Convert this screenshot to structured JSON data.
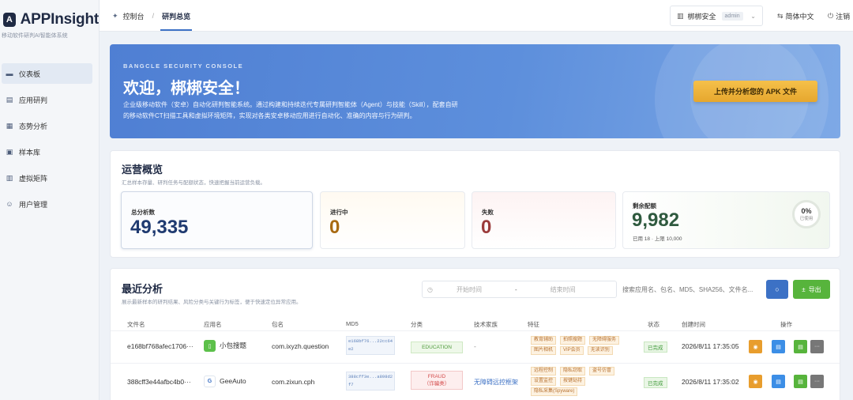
{
  "app": {
    "name": "APPInsight",
    "subtitle": "移动软件研判AI智能体系统"
  },
  "sidebar": {
    "items": [
      {
        "label": "仪表板",
        "icon": "monitor-icon",
        "active": true
      },
      {
        "label": "应用研判",
        "icon": "document-icon"
      },
      {
        "label": "态势分析",
        "icon": "chart-icon"
      },
      {
        "label": "样本库",
        "icon": "box-icon"
      },
      {
        "label": "虚拟矩阵",
        "icon": "grid-icon"
      },
      {
        "label": "用户管理",
        "icon": "user-icon"
      }
    ]
  },
  "header": {
    "breadcrumb": [
      "控制台",
      "研判总览"
    ],
    "user": {
      "name": "梆梆安全",
      "role": "admin"
    },
    "language": "简体中文",
    "logout": "注销"
  },
  "hero": {
    "kicker": "BANGCLE SECURITY CONSOLE",
    "title": "欢迎，梆梆安全！",
    "line1": "企业级移动软件（安卓）自动化研判智能系统。通过构建和持续迭代专属研判智能体（Agent）与技能（Skill），配套自研",
    "line2": "的移动软件CT扫描工具和虚拟环境矩阵，实现对各类安卓移动应用进行自动化、准确的内容与行为研判。",
    "upload_label": "上传并分析您的 APK 文件"
  },
  "ops": {
    "title": "运营概览",
    "subtitle": "汇总样本存量、研判任务与配额状态，快速把握当前运营负载。",
    "cards": [
      {
        "label": "总分析数",
        "value": "49,335"
      },
      {
        "label": "进行中",
        "value": "0"
      },
      {
        "label": "失败",
        "value": "0"
      },
      {
        "label": "剩余配额",
        "value": "9,982",
        "foot": "已用 18 · 上限 10,000",
        "usage": "0%",
        "usage_label": "已使用"
      }
    ]
  },
  "recent": {
    "title": "最近分析",
    "subtitle": "展示最新样本的研判结果、风险分类与关键行为标签，便于快速定位异常应用。",
    "start_placeholder": "开始时间",
    "range_sep": "-",
    "end_placeholder": "结束时间",
    "search_placeholder": "搜索应用名、包名、MD5、SHA256、文件名...",
    "export_label": "导出",
    "columns": [
      "文件名",
      "应用名",
      "包名",
      "MD5",
      "分类",
      "技术家族",
      "特征",
      "状态",
      "创建时间",
      "操作"
    ],
    "rows": [
      {
        "file": "e168bf768afec1706···",
        "app": "小包搜题",
        "app_icon": "app-green-icon",
        "pkg": "com.ixyzh.question",
        "md5_line1": "e168bf76...22cc64",
        "md5_line2": "e2",
        "category_line1": "EDUCATION",
        "category_line2": "",
        "family": "-",
        "tags": [
          "教育辅助",
          "拍照搜题",
          "无障碍服务",
          "图片相机",
          "VIP会员",
          "无读识别"
        ],
        "status": "已完成",
        "created": "2026/8/11 17:35:05"
      },
      {
        "file": "388cff3e44afbc4b0···",
        "app": "GeeAuto",
        "app_icon": "app-g-icon",
        "app_letter": "G",
        "pkg": "com.zixun.cph",
        "md5_line1": "388cff3e...a898d2",
        "md5_line2": "f7",
        "category_line1": "FRAUD",
        "category_line2": "（诈骗类）",
        "family": "无障碍远控框架",
        "tags": [
          "远程控制",
          "隐私窃取",
          "盗号仿冒",
          "设置监控",
          "按键劫持",
          "隐私采集(Spyware)"
        ],
        "status": "已完成",
        "created": "2026/8/11 17:35:02"
      }
    ]
  },
  "colors": {
    "primary": "#3c71c5",
    "accent_gold": "#e6a72e",
    "success": "#57b43c",
    "action_orange": "#e89d2d",
    "action_blue": "#3c8ee6",
    "action_green": "#57b43c",
    "action_gray": "#777777"
  }
}
